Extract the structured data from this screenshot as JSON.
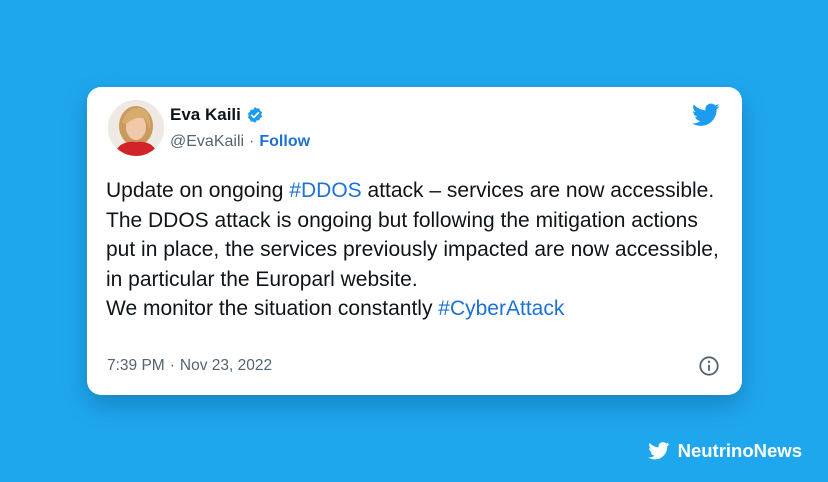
{
  "tweet": {
    "author_name": "Eva Kaili",
    "handle": "@EvaKaili",
    "separator": "·",
    "follow_label": "Follow",
    "body": {
      "p1_before": "Update on ongoing ",
      "p1_hashtag": "#DDOS",
      "p1_after": " attack – services are now accessible.",
      "p2": "The DDOS attack is ongoing but following the mitigation actions put in place, the services previously impacted are now accessible, in particular the Europarl website.",
      "p3_before": "We monitor the situation constantly ",
      "p3_hashtag": "#CyberAttack"
    },
    "time": "7:39 PM",
    "date": "Nov 23, 2022",
    "icons": {
      "verified": "verified-badge-icon",
      "platform": "twitter-bird-icon",
      "info": "info-icon"
    }
  },
  "brand": {
    "name": "NeutrinoNews",
    "icon": "twitter-bird-icon"
  },
  "colors": {
    "background": "#1fa7ee",
    "card": "#ffffff",
    "link": "#1d72d5",
    "text": "#0f1419",
    "muted": "#536471",
    "twitter_blue": "#1d9bf0"
  }
}
